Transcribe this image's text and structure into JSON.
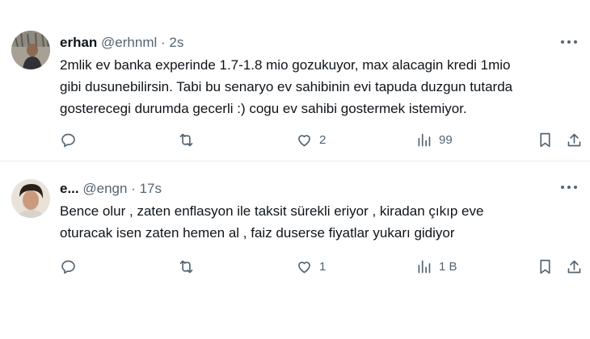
{
  "tweets": [
    {
      "name": "erhan",
      "handle": "@erhnml",
      "separator": "·",
      "time": "2s",
      "text_lines": [
        "2mlik ev banka experinde 1.7-1.8 mio gozukuyor, max alacagin kredi 1mio",
        "gibi dusunebilirsin. Tabi bu senaryo ev sahibinin evi tapuda duzgun tutarda",
        "gosterecegi durumda gecerli :) cogu ev sahibi gostermek istemiyor."
      ],
      "likes": "2",
      "views": "99"
    },
    {
      "name": "e...",
      "handle": "@engn",
      "separator": "·",
      "time": "17s",
      "text_lines": [
        "Bence olur , zaten enflasyon ile taksit sürekli eriyor , kiradan çıkıp eve",
        "oturacak isen zaten hemen al , faiz duserse fiyatlar yukarı gidiyor"
      ],
      "likes": "1",
      "views": "1 B"
    }
  ],
  "icons": {
    "reply": "reply-icon",
    "retweet": "retweet-icon",
    "like": "like-icon",
    "views": "views-icon",
    "bookmark": "bookmark-icon",
    "share": "share-icon",
    "more": "more-icon"
  },
  "colors": {
    "text": "#0f1419",
    "secondary": "#536471",
    "divider": "#e6ecf0"
  }
}
